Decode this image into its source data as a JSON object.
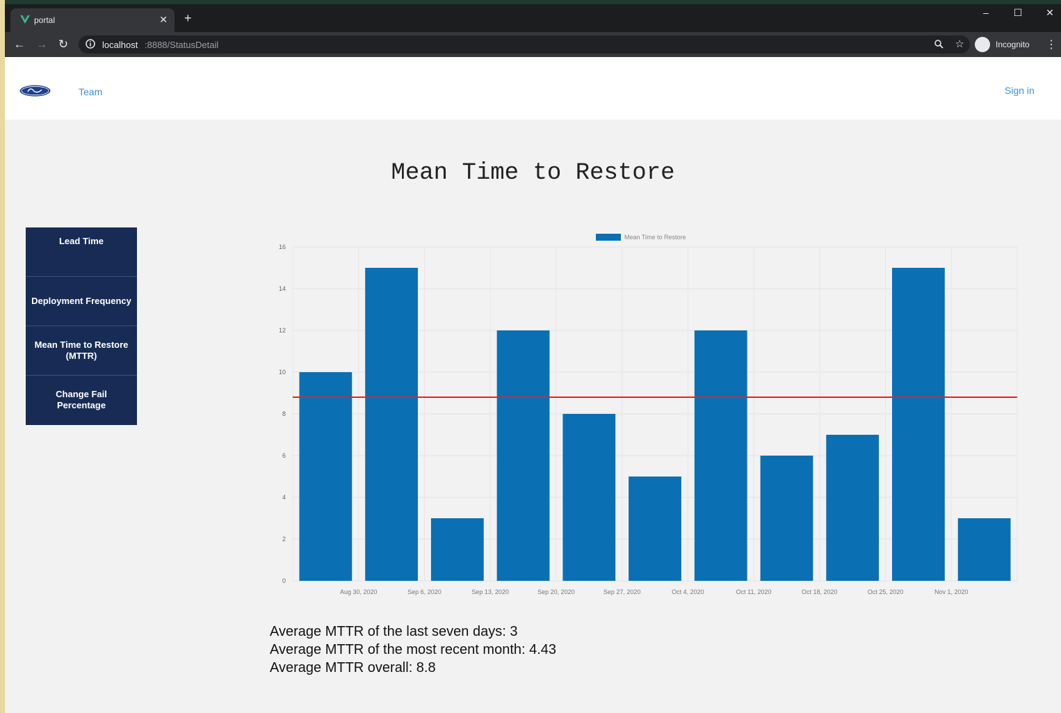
{
  "browser": {
    "tab_title": "portal",
    "url_host": "localhost",
    "url_rest": ":8888/StatusDetail",
    "incognito_label": "Incognito"
  },
  "navbar": {
    "team_link": "Team",
    "sign_in": "Sign in"
  },
  "page_title": "Mean Time to Restore",
  "sidenav": {
    "items": [
      "Lead Time",
      "Deployment Frequency",
      "Mean Time to Restore (MTTR)",
      "Change Fail Percentage"
    ]
  },
  "chart_data": {
    "type": "bar",
    "title": "",
    "legend": [
      "Mean Time to Restore"
    ],
    "legend_position": "top",
    "series": [
      {
        "name": "Mean Time to Restore",
        "values": [
          10,
          15,
          3,
          12,
          8,
          5,
          12,
          6,
          7,
          15,
          3
        ],
        "color": "#0b70b3"
      }
    ],
    "x_tick_labels": [
      "Aug 30, 2020",
      "Sep 6, 2020",
      "Sep 13, 2020",
      "Sep 20, 2020",
      "Sep 27, 2020",
      "Oct 4, 2020",
      "Oct 11, 2020",
      "Oct 18, 2020",
      "Oct 25, 2020",
      "Nov 1, 2020"
    ],
    "y_ticks": [
      0,
      2,
      4,
      6,
      8,
      10,
      12,
      14,
      16
    ],
    "ylim": [
      0,
      16
    ],
    "average_line": {
      "value": 8.8,
      "color": "#e52222"
    },
    "grid": true
  },
  "stats": {
    "line1": "Average MTTR of the last seven days: 3",
    "line2": "Average MTTR of the most recent month: 4.43",
    "line3": "Average MTTR overall: 8.8"
  }
}
